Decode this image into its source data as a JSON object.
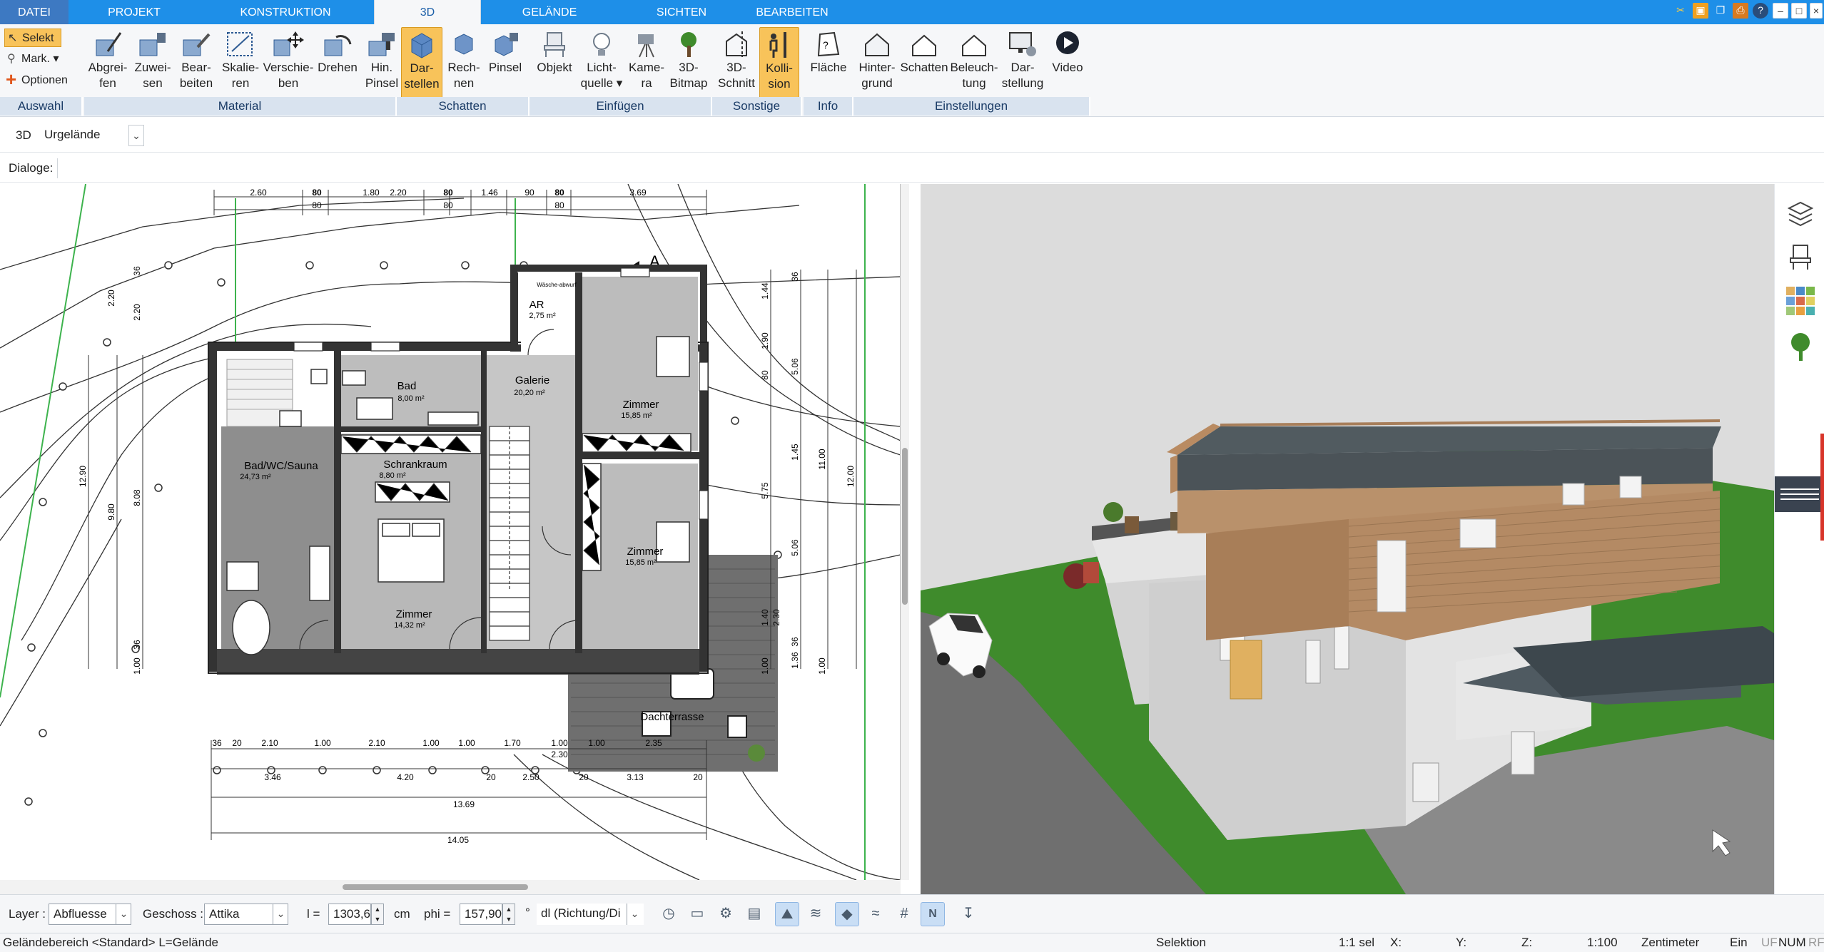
{
  "menubar": {
    "tabs": [
      "DATEI",
      "PROJEKT",
      "KONSTRUKTION",
      "3D",
      "GELÄNDE",
      "SICHTEN",
      "BEARBEITEN"
    ],
    "active": "3D"
  },
  "ribbon": {
    "auswahl": {
      "selekt": "Selekt",
      "mark": "Mark.",
      "optionen": "Optionen",
      "group": "Auswahl"
    },
    "material": {
      "b1a": "Abgrei-",
      "b1b": "fen",
      "b2a": "Zuwei-",
      "b2b": "sen",
      "b3a": "Bear-",
      "b3b": "beiten",
      "b4a": "Skalie-",
      "b4b": "ren",
      "b5a": "Verschie-",
      "b5b": "ben",
      "b6": "Drehen",
      "b7a": "Hin.",
      "b7b": "Pinsel",
      "group": "Material"
    },
    "schatten": {
      "b1a": "Dar-",
      "b1b": "stellen",
      "b2a": "Rech-",
      "b2b": "nen",
      "b3": "Pinsel",
      "group": "Schatten"
    },
    "einfuegen": {
      "b1": "Objekt",
      "b2a": "Licht-",
      "b2b": "quelle",
      "b3a": "Kame-",
      "b3b": "ra",
      "b4a": "3D-",
      "b4b": "Bitmap",
      "group": "Einfügen"
    },
    "sonstige": {
      "b1a": "3D-",
      "b1b": "Schnitt",
      "b2a": "Kolli-",
      "b2b": "sion",
      "group": "Sonstige"
    },
    "info": {
      "b1": "Fläche",
      "group": "Info"
    },
    "einstellungen": {
      "b1a": "Hinter-",
      "b1b": "grund",
      "b2": "Schatten",
      "b3a": "Beleuch-",
      "b3b": "tung",
      "b4a": "Dar-",
      "b4b": "stellung",
      "b5": "Video",
      "group": "Einstellungen"
    }
  },
  "toolrow": {
    "mode": "3D",
    "terrain": "Urgelände"
  },
  "dialogs": {
    "label": "Dialoge:"
  },
  "plan": {
    "rooms": [
      {
        "name": "Bad",
        "area": "8,00 m²"
      },
      {
        "name": "Galerie",
        "area": "20,20 m²"
      },
      {
        "name": "AR",
        "area": "2,75 m²"
      },
      {
        "name": "Zimmer",
        "area": "15,85 m²"
      },
      {
        "name": "Bad/WC/Sauna",
        "area": "24,73 m²"
      },
      {
        "name": "Schrankraum",
        "area": "8,80 m²"
      },
      {
        "name": "Zimmer",
        "area": "15,85 m²"
      },
      {
        "name": "Zimmer",
        "area": "14,32 m²"
      },
      {
        "name": "Dachterrasse",
        "area": ""
      }
    ],
    "waesche": "Wäsche-abwurf",
    "top_dims": [
      "2.60",
      "80",
      "1.80",
      "80",
      "2.20",
      "80",
      "1.80",
      "1.46",
      "90",
      "80",
      "3.69"
    ],
    "top_dims2": [
      "80",
      "80",
      "80"
    ],
    "bottom_dims1": [
      "36",
      "20",
      "2.10",
      "1.00",
      "2.10",
      "1.00",
      "1.00",
      "1.70",
      "1.00",
      "1.00"
    ],
    "bottom_dims2": [
      "3.46",
      "4.20",
      "20",
      "2.50",
      "20",
      "3.13",
      "20"
    ],
    "extra_dims": [
      "2.30",
      "2.35"
    ],
    "total1": "13.69",
    "total2": "14.05",
    "left_dims": [
      "36",
      "2.20",
      "2.20",
      "12.90",
      "9.80",
      "8.08",
      "36",
      "1.00"
    ],
    "right_dims": [
      "36",
      "1.44",
      "1.90",
      "80",
      "5.06",
      "1.45",
      "11.00",
      "12.00",
      "5.75",
      "5.06",
      "1.40",
      "2.30",
      "1.36",
      "1.00",
      "1.00",
      "36"
    ],
    "section": "A"
  },
  "bottom": {
    "layer_label": "Layer :",
    "layer_value": "Abfluesse",
    "geschoss_label": "Geschoss :",
    "geschoss_value": "Attika",
    "l_label": "l =",
    "l_value": "1303,6",
    "l_unit": "cm",
    "phi_label": "phi =",
    "phi_value": "157,90",
    "phi_unit": "°",
    "dl_value": "dl (Richtung/Di",
    "n_label": "N"
  },
  "status": {
    "left": "Geländebereich <Standard> L=Gelände",
    "mode": "Selektion",
    "sel": "1:1 sel",
    "x": "X:",
    "y": "Y:",
    "z": "Z:",
    "scale": "1:100",
    "unit": "Zentimeter",
    "ein": "Ein",
    "uf": "UF",
    "num": "NUM",
    "rf": "RF"
  },
  "colors": {
    "accent": "#1e8fe8",
    "selected": "#f8c35a",
    "grass": "#3f8b2c",
    "sky": "#dedede"
  }
}
